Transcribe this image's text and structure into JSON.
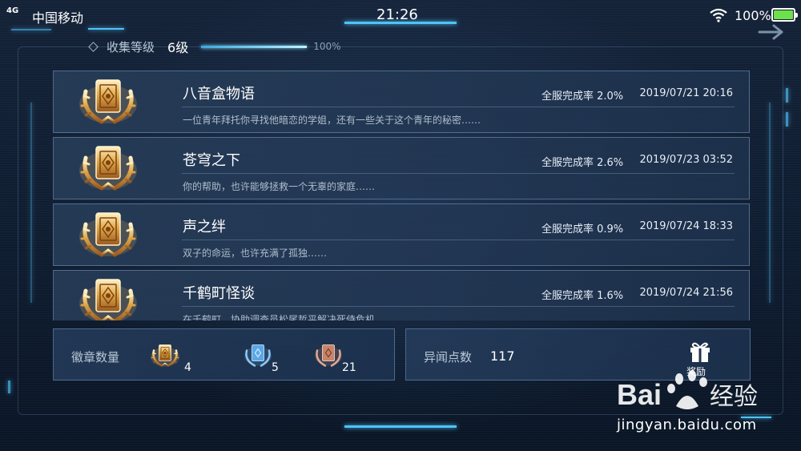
{
  "status_bar": {
    "network": "4G",
    "carrier": "中国移动",
    "time": "21:26",
    "battery": "100%"
  },
  "collection": {
    "label": "收集等级",
    "level": "6级",
    "progress_text": "100%",
    "progress": 1.0
  },
  "achievements": [
    {
      "title": "八音盒物语",
      "rate": "全服完成率 2.0%",
      "date": "2019/07/21 20:16",
      "desc": "一位青年拜托你寻找他暗恋的学姐，还有一些关于这个青年的秘密……"
    },
    {
      "title": "苍穹之下",
      "rate": "全服完成率 2.6%",
      "date": "2019/07/23 03:52",
      "desc": "你的帮助，也许能够拯救一个无辜的家庭……"
    },
    {
      "title": "声之绊",
      "rate": "全服完成率 0.9%",
      "date": "2019/07/24 18:33",
      "desc": "双子的命运，也许充满了孤独……"
    },
    {
      "title": "千鹤町怪谈",
      "rate": "全服完成率 1.6%",
      "date": "2019/07/24 21:56",
      "desc": "在千鹤町，协助调查员松尾哲平解决死侍危机。"
    }
  ],
  "badges": {
    "label": "徽章数量",
    "gold": "4",
    "blue": "5",
    "copper": "21"
  },
  "points": {
    "label": "异闻点数",
    "value": "117",
    "reward_label": "奖励"
  },
  "watermark": {
    "logo_text": "Bai 经验",
    "url": "jingyan.baidu.com"
  },
  "colors": {
    "accent": "#4fc3f7",
    "badge_gold": "#d9a441",
    "badge_blue": "#5aa8e8",
    "badge_copper": "#c8846a"
  }
}
